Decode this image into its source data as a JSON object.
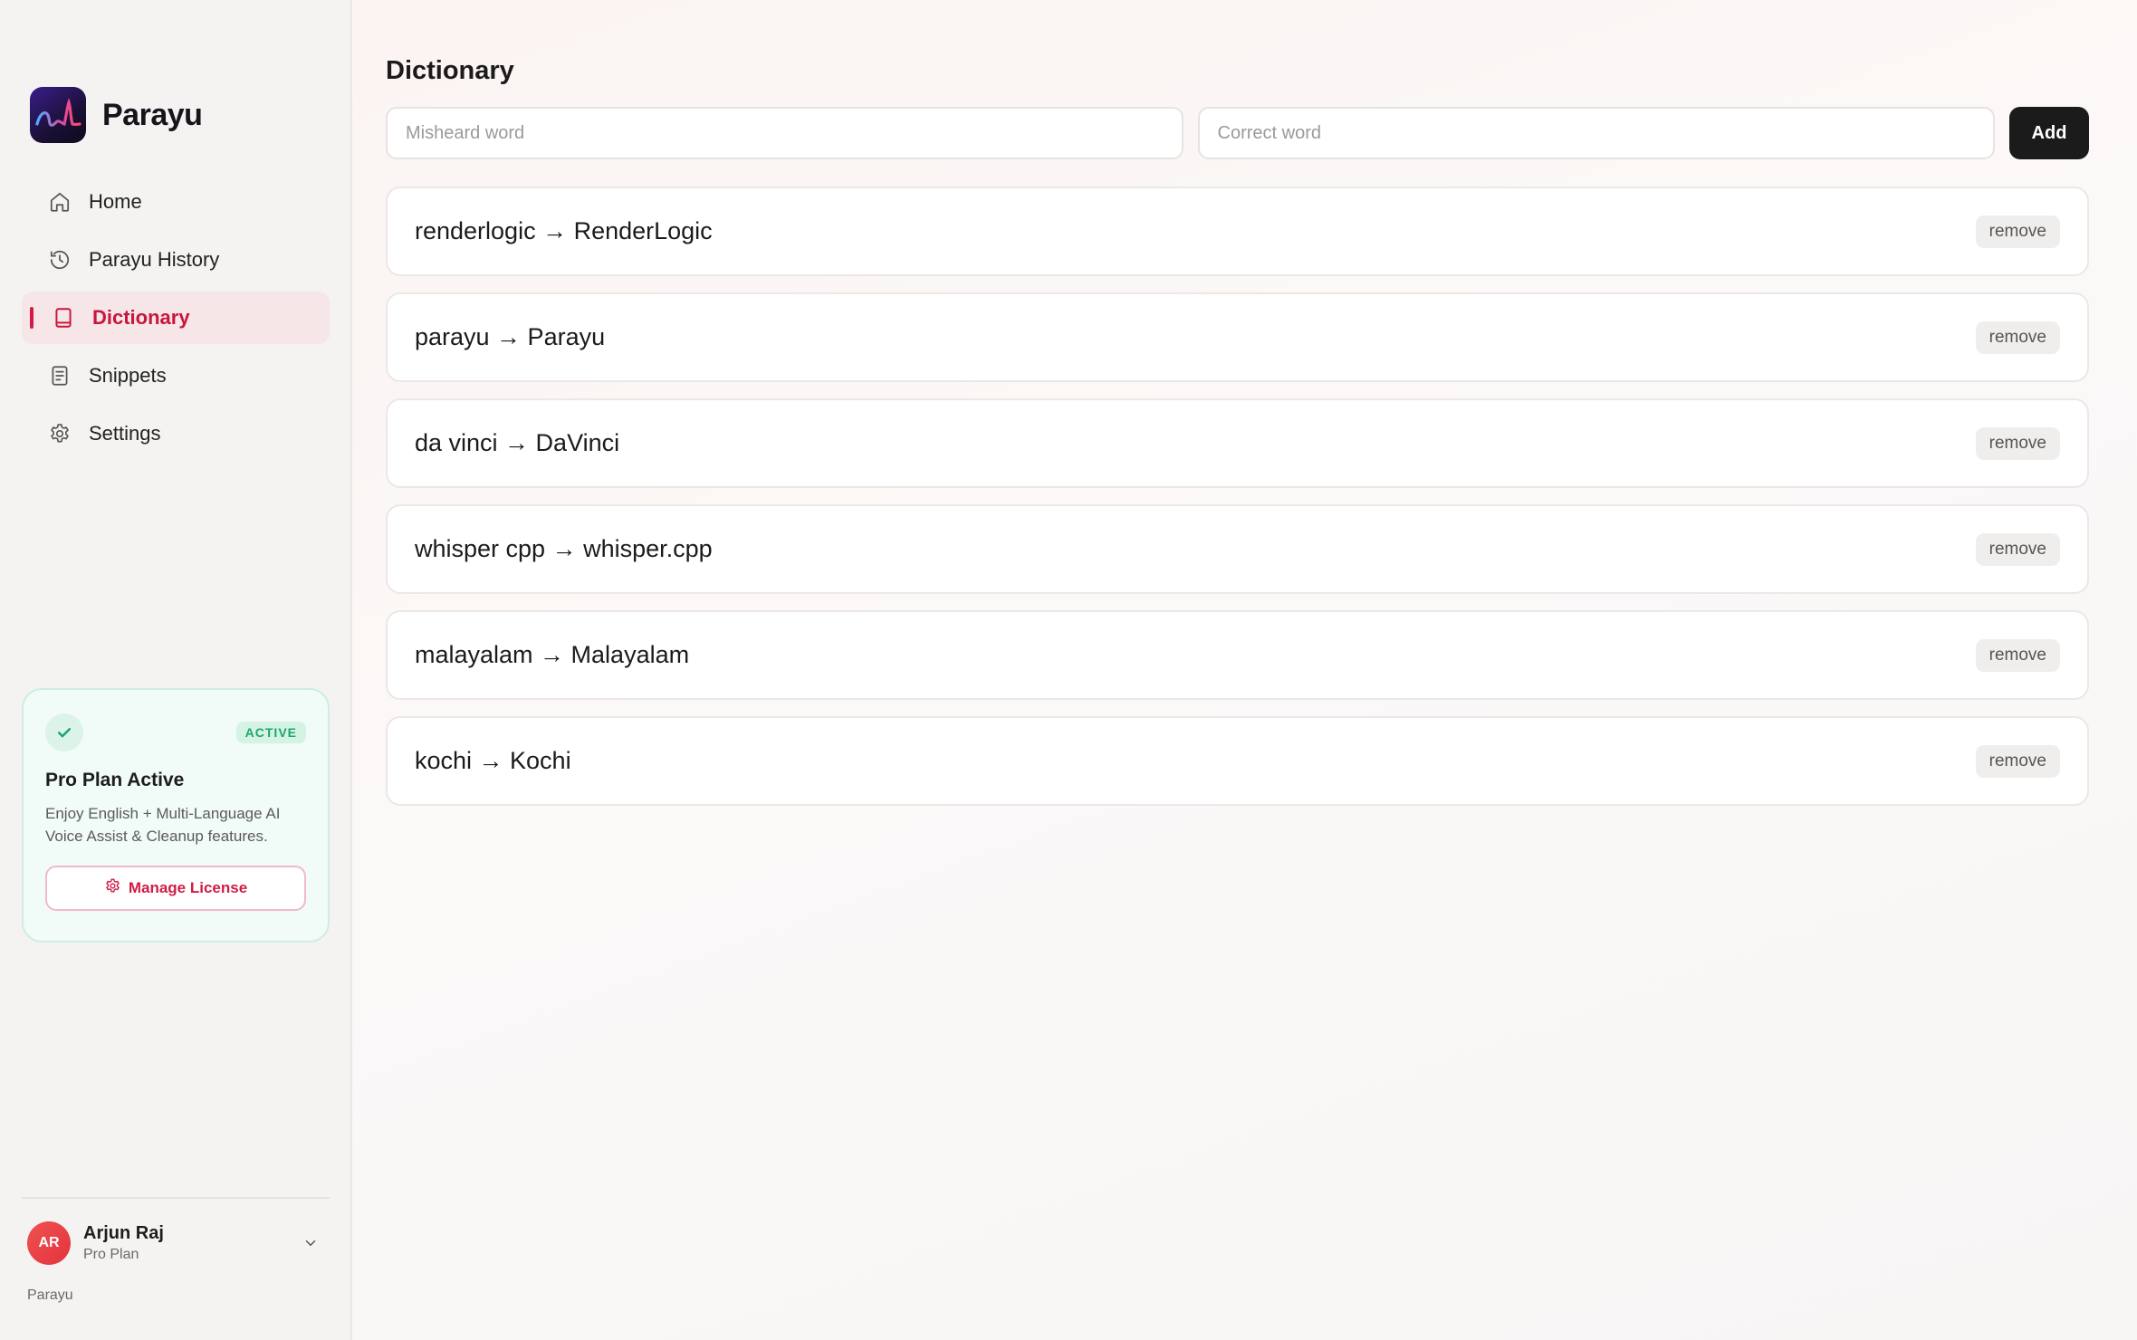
{
  "app": {
    "name": "Parayu"
  },
  "sidebar": {
    "items": [
      {
        "label": "Home",
        "icon": "home-icon",
        "active": false
      },
      {
        "label": "Parayu History",
        "icon": "history-icon",
        "active": false
      },
      {
        "label": "Dictionary",
        "icon": "book-icon",
        "active": true
      },
      {
        "label": "Snippets",
        "icon": "document-icon",
        "active": false
      },
      {
        "label": "Settings",
        "icon": "gear-icon",
        "active": false
      }
    ],
    "plan_card": {
      "badge": "ACTIVE",
      "title": "Pro Plan Active",
      "description": "Enjoy English + Multi-Language AI Voice Assist & Cleanup features.",
      "button_label": "Manage License"
    },
    "user": {
      "initials": "AR",
      "name": "Arjun Raj",
      "plan": "Pro Plan"
    },
    "footer": "Parayu"
  },
  "main": {
    "title": "Dictionary",
    "form": {
      "misheard_placeholder": "Misheard word",
      "correct_placeholder": "Correct word",
      "misheard_value": "",
      "correct_value": "",
      "add_label": "Add"
    },
    "entries": [
      {
        "text": "renderlogic → RenderLogic",
        "remove_label": "remove"
      },
      {
        "text": "parayu → Parayu",
        "remove_label": "remove"
      },
      {
        "text": "da vinci → DaVinci",
        "remove_label": "remove"
      },
      {
        "text": "whisper cpp → whisper.cpp",
        "remove_label": "remove"
      },
      {
        "text": "malayalam → Malayalam",
        "remove_label": "remove"
      },
      {
        "text": "kochi → Kochi",
        "remove_label": "remove"
      }
    ]
  },
  "colors": {
    "accent": "#d51b44",
    "active_bg": "#f6e6e8",
    "success": "#1fa56b",
    "primary_button": "#1b1b1b"
  }
}
